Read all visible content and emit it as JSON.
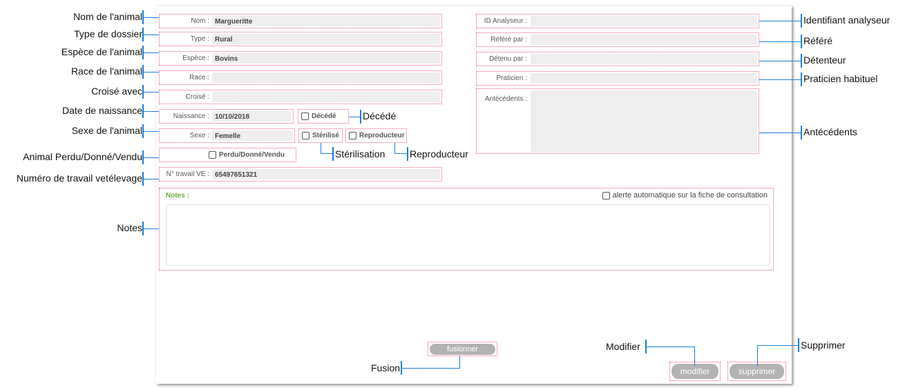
{
  "form": {
    "nom": {
      "label": "Nom :",
      "value": "Margueritte"
    },
    "type": {
      "label": "Type :",
      "value": "Rural"
    },
    "espece": {
      "label": "Espèce :",
      "value": "Bovins"
    },
    "race": {
      "label": "Race :",
      "value": ""
    },
    "croise": {
      "label": "Croisé :",
      "value": ""
    },
    "naissance": {
      "label": "Naissance :",
      "value": "10/10/2018"
    },
    "decede": {
      "label": "Décédé",
      "checked": false
    },
    "sexe": {
      "label": "Sexe :",
      "value": "Femelle"
    },
    "sterilise": {
      "label": "Stérilisé",
      "checked": false
    },
    "reproducteur": {
      "label": "Reproducteur",
      "checked": false
    },
    "perdu": {
      "label": "Perdu/Donné/Vendu",
      "checked": false
    },
    "travail": {
      "label": "N° travail VE :",
      "value": "65497651321"
    },
    "id_analyseur": {
      "label": "ID Analyseur :",
      "value": ""
    },
    "refere": {
      "label": "Référé par :",
      "value": ""
    },
    "detenu": {
      "label": "Détenu par :",
      "value": ""
    },
    "praticien": {
      "label": "Praticien :",
      "value": ""
    },
    "antecedents": {
      "label": "Antécédents :",
      "value": ""
    },
    "notes": {
      "label": "Notes :",
      "value": "",
      "alert_label": "alerte automatique sur la fiche de consultation",
      "alert_checked": false
    },
    "buttons": {
      "fusion": "fusionner",
      "modifier": "modifier",
      "supprimer": "supprimer"
    }
  },
  "annotations": {
    "left": [
      "Nom de l'animal",
      "Type de dossier",
      "Espèce de l'animal",
      "Race de l'animal",
      "Croisé avec",
      "Date de naissance",
      "Sexe de l'animal",
      "Animal Perdu/Donné/Vendu",
      "Numéro de travail vetélevage",
      "Notes"
    ],
    "right": [
      "Identifiant analyseur",
      "Référé",
      "Détenteur",
      "Praticien habituel",
      "Antécédents"
    ],
    "decede": "Décédé",
    "sterilisation": "Stérilisation",
    "reproducteur": "Reproducteur",
    "modifier": "Modifier",
    "supprimer": "Supprimer",
    "fusion": "Fusion"
  },
  "colors": {
    "border": "#e8577f",
    "annotation": "#1a7de0",
    "notes_label": "#6aab3a",
    "button": "#b3b3b3"
  }
}
